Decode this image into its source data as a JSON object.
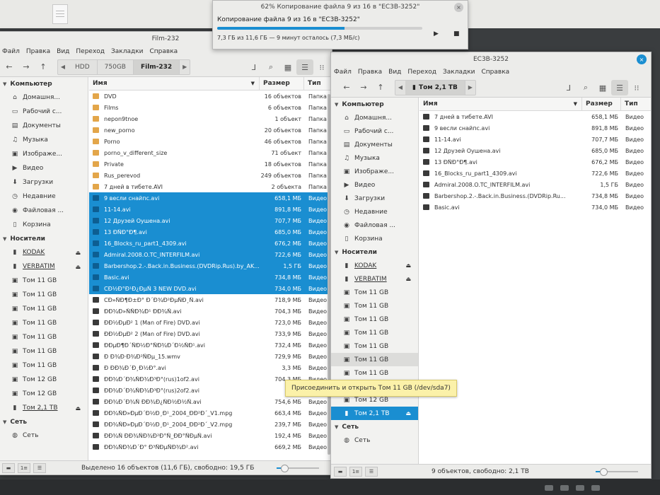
{
  "progress": {
    "title": "62% Копирование файла 9 из 16 в \"EC3B-3252\"",
    "main": "Копирование файла 9 из 16 в \"EC3B-3252\"",
    "detail": "7,3 ГБ из 11,6 ГБ — 9 минут осталось (7,3 МБ/с)",
    "percent": 62,
    "close_icon": "×",
    "play_icon": "▶",
    "stop_icon": "■"
  },
  "menu_labels": [
    "Файл",
    "Правка",
    "Вид",
    "Переход",
    "Закладки",
    "Справка"
  ],
  "left": {
    "title": "Film-232",
    "crumbs": [
      "HDD",
      "750GB",
      "Film-232"
    ],
    "sidebar": {
      "computer": "Компьютер",
      "places": [
        {
          "label": "Домашня...",
          "icon": "⌂"
        },
        {
          "label": "Рабочий с...",
          "icon": "▭"
        },
        {
          "label": "Документы",
          "icon": "▤"
        },
        {
          "label": "Музыка",
          "icon": "♫"
        },
        {
          "label": "Изображе...",
          "icon": "▣"
        },
        {
          "label": "Видео",
          "icon": "▶"
        },
        {
          "label": "Загрузки",
          "icon": "⬇"
        },
        {
          "label": "Недавние",
          "icon": "◷"
        },
        {
          "label": "Файловая ...",
          "icon": "◉"
        },
        {
          "label": "Корзина",
          "icon": "▯"
        }
      ],
      "devices_head": "Носители",
      "devices": [
        {
          "label": "KODAK",
          "icon": "▮",
          "eject": true,
          "u": true
        },
        {
          "label": "VERBATIM",
          "icon": "▮",
          "eject": true,
          "u": true
        },
        {
          "label": "Том 11 GB",
          "icon": "▣"
        },
        {
          "label": "Том 11 GB",
          "icon": "▣"
        },
        {
          "label": "Том 11 GB",
          "icon": "▣"
        },
        {
          "label": "Том 11 GB",
          "icon": "▣"
        },
        {
          "label": "Том 11 GB",
          "icon": "▣"
        },
        {
          "label": "Том 11 GB",
          "icon": "▣"
        },
        {
          "label": "Том 11 GB",
          "icon": "▣"
        },
        {
          "label": "Том 12 GB",
          "icon": "▣"
        },
        {
          "label": "Том 12 GB",
          "icon": "▣"
        },
        {
          "label": "Том 2,1 ТВ",
          "icon": "▮",
          "eject": true,
          "u": true
        }
      ],
      "network_head": "Сеть",
      "network": [
        {
          "label": "Сеть",
          "icon": "◍"
        }
      ]
    },
    "columns": [
      "Имя",
      "Размер",
      "Тип"
    ],
    "rows": [
      {
        "name": "DVD",
        "size": "16 объектов",
        "type": "Папка",
        "kind": "folder"
      },
      {
        "name": "Films",
        "size": "6 объектов",
        "type": "Папка",
        "kind": "folder"
      },
      {
        "name": "nepon9tnoe",
        "size": "1 объект",
        "type": "Папка",
        "kind": "folder"
      },
      {
        "name": "new_porno",
        "size": "20 объектов",
        "type": "Папка",
        "kind": "folder"
      },
      {
        "name": "Porno",
        "size": "46 объектов",
        "type": "Папка",
        "kind": "folder"
      },
      {
        "name": "porno_v_different_size",
        "size": "71 объект",
        "type": "Папка",
        "kind": "folder"
      },
      {
        "name": "Private",
        "size": "18 объектов",
        "type": "Папка",
        "kind": "folder"
      },
      {
        "name": "Rus_perevod",
        "size": "249 объектов",
        "type": "Папка",
        "kind": "folder"
      },
      {
        "name": "7 дней в тибете.AVI",
        "size": "2 объекта",
        "type": "Папка",
        "kind": "folder"
      },
      {
        "name": "9 весли снайпс.avi",
        "size": "658,1 МБ",
        "type": "Видео",
        "kind": "video",
        "sel": true
      },
      {
        "name": "11-14.avi",
        "size": "891,8 МБ",
        "type": "Видео",
        "kind": "video",
        "sel": true
      },
      {
        "name": "12 Друзей Оушена.avi",
        "size": "707,7 МБ",
        "type": "Видео",
        "kind": "video",
        "sel": true
      },
      {
        "name": "13 ÐÑÐ°Ð¶.avi",
        "size": "685,0 МБ",
        "type": "Видео",
        "kind": "video",
        "sel": true
      },
      {
        "name": "16_Blocks_ru_part1_4309.avi",
        "size": "676,2 МБ",
        "type": "Видео",
        "kind": "video",
        "sel": true
      },
      {
        "name": "Admiral.2008.O.TC_INTERFILM.avi",
        "size": "722,6 МБ",
        "type": "Видео",
        "kind": "video",
        "sel": true
      },
      {
        "name": "Barbershop.2.-.Back.in.Business.(DVDRip.Rus).by_AK...",
        "size": "1,5 ГБ",
        "type": "Видео",
        "kind": "video",
        "sel": true
      },
      {
        "name": "Basic.avi",
        "size": "734,8 МБ",
        "type": "Видео",
        "kind": "video",
        "sel": true
      },
      {
        "name": "CÐ½Ð°Ð¹Ð¿ÐµÑ 3 NEW DVD.avi",
        "size": "734,0 МБ",
        "type": "Видео",
        "kind": "video",
        "sel": true
      },
      {
        "name": "CÐ»ÑÐ¶Ð±Ð° Ð´Ð¾Ð²ÐµÑÐ¸Ñ.avi",
        "size": "718,9 МБ",
        "type": "Видео",
        "kind": "video"
      },
      {
        "name": "ÐÐ¾Ð»ÑÑÐ¾Ð¹ ÐÐ¾Ñ.avi",
        "size": "704,3 МБ",
        "type": "Видео",
        "kind": "video"
      },
      {
        "name": "ÐÐ½ÐµÐ² 1 (Man of Fire) DVD.avi",
        "size": "723,0 МБ",
        "type": "Видео",
        "kind": "video"
      },
      {
        "name": "ÐÐ½ÐµÐ² 2 (Man of Fire) DVD.avi",
        "size": "733,9 МБ",
        "type": "Видео",
        "kind": "video"
      },
      {
        "name": "ÐÐµÐ¶Ð´ÑÐ½Ð°ÑÐ¾Ð´Ð½ÑÐ¹.avi",
        "size": "732,4 МБ",
        "type": "Видео",
        "kind": "video"
      },
      {
        "name": "Ð Ð¾Ð·Ð¾Ð²ÑÐµ_15.wmv",
        "size": "729,9 МБ",
        "type": "Видео",
        "kind": "video"
      },
      {
        "name": "Ð ÐÐ¾Ð´Ð¸Ð½Ð°.avi",
        "size": "3,3 МБ",
        "type": "Видео",
        "kind": "video"
      },
      {
        "name": "ÐÐ¾Ð´Ð¾ÑÐ¾Ð³Ð°(rus)1of2.avi",
        "size": "704,3 МБ",
        "type": "Видео",
        "kind": "video"
      },
      {
        "name": "ÐÐ¾Ð´Ð¾ÑÐ¾Ð³Ð°(rus)2of2.avi",
        "size": "755,",
        "type": "Видео",
        "kind": "video"
      },
      {
        "name": "ÐÐ¾Ð´Ð¾Ñ ÐÐ¾Ð¿ÑÐ½Ð½Ñ.avi",
        "size": "754,6 МБ",
        "type": "Видео",
        "kind": "video"
      },
      {
        "name": "ÐÐ¾ÑÐ»ÐµÐ´Ð½Ð¸Ð¹_2004_ÐÐ²Ð´_V1.mpg",
        "size": "663,4 МБ",
        "type": "Видео",
        "kind": "video"
      },
      {
        "name": "ÐÐ¾ÑÐ»ÐµÐ´Ð½Ð¸Ð¹_2004_ÐÐ²Ð´_V2.mpg",
        "size": "239,7 МБ",
        "type": "Видео",
        "kind": "video"
      },
      {
        "name": "ÐÐ¾Ñ ÐÐ¾ÑÐ¾Ð²Ð°Ñ_ÐÐ°ÑÐµÑ.avi",
        "size": "192,4 МБ",
        "type": "Видео",
        "kind": "video"
      },
      {
        "name": "ÐÐ¾ÑÐ¾Ð´Ð° Ð³ÑÐµÑÐ¾Ð².avi",
        "size": "669,2 МБ",
        "type": "Видео",
        "kind": "video"
      }
    ],
    "status": "Выделено 16 объектов (11,6 ГБ), свободно: 19,5 ГБ"
  },
  "right": {
    "title": "EC3B-3252",
    "crumbs": [
      "Том 2,1 ТВ"
    ],
    "sidebar": {
      "computer": "Компьютер",
      "places": [
        {
          "label": "Домашня...",
          "icon": "⌂"
        },
        {
          "label": "Рабочий с...",
          "icon": "▭"
        },
        {
          "label": "Документы",
          "icon": "▤"
        },
        {
          "label": "Музыка",
          "icon": "♫"
        },
        {
          "label": "Изображе...",
          "icon": "▣"
        },
        {
          "label": "Видео",
          "icon": "▶"
        },
        {
          "label": "Загрузки",
          "icon": "⬇"
        },
        {
          "label": "Недавние",
          "icon": "◷"
        },
        {
          "label": "Файловая ...",
          "icon": "◉"
        },
        {
          "label": "Корзина",
          "icon": "▯"
        }
      ],
      "devices_head": "Носители",
      "devices": [
        {
          "label": "KODAK",
          "icon": "▮",
          "eject": true,
          "u": true
        },
        {
          "label": "VERBATIM",
          "icon": "▮",
          "eject": true,
          "u": true
        },
        {
          "label": "Том 11 GB",
          "icon": "▣"
        },
        {
          "label": "Том 11 GB",
          "icon": "▣"
        },
        {
          "label": "Том 11 GB",
          "icon": "▣"
        },
        {
          "label": "Том 11 GB",
          "icon": "▣"
        },
        {
          "label": "Том 11 GB",
          "icon": "▣"
        },
        {
          "label": "Том 11 GB",
          "icon": "▣",
          "hover": true
        },
        {
          "label": "Том 11 GB",
          "icon": "▣"
        },
        {
          "label": "Том 12 GB",
          "icon": "▣"
        },
        {
          "label": "Том 12 GB",
          "icon": "▣"
        },
        {
          "label": "Том 2,1 ТВ",
          "icon": "▮",
          "eject": true,
          "sel": true
        }
      ],
      "network_head": "Сеть",
      "network": [
        {
          "label": "Сеть",
          "icon": "◍"
        }
      ]
    },
    "columns": [
      "Имя",
      "Размер",
      "Тип"
    ],
    "rows": [
      {
        "name": "7 дней в тибете.AVI",
        "size": "658,1 МБ",
        "type": "Видео",
        "kind": "video"
      },
      {
        "name": "9 весли снайпс.avi",
        "size": "891,8 МБ",
        "type": "Видео",
        "kind": "video"
      },
      {
        "name": "11-14.avi",
        "size": "707,7 МБ",
        "type": "Видео",
        "kind": "video"
      },
      {
        "name": "12 Друзей Оушена.avi",
        "size": "685,0 МБ",
        "type": "Видео",
        "kind": "video"
      },
      {
        "name": "13 ÐÑÐ°Ð¶.avi",
        "size": "676,2 МБ",
        "type": "Видео",
        "kind": "video"
      },
      {
        "name": "16_Blocks_ru_part1_4309.avi",
        "size": "722,6 МБ",
        "type": "Видео",
        "kind": "video"
      },
      {
        "name": "Admiral.2008.O.TC_INTERFILM.avi",
        "size": "1,5 ГБ",
        "type": "Видео",
        "kind": "video"
      },
      {
        "name": "Barbershop.2.-.Back.in.Business.(DVDRip.Ru...",
        "size": "734,8 МБ",
        "type": "Видео",
        "kind": "video"
      },
      {
        "name": "Basic.avi",
        "size": "734,0 МБ",
        "type": "Видео",
        "kind": "video"
      }
    ],
    "status": "9 объектов, свободно: 2,1 ТВ"
  },
  "tooltip": "Присоединить и открыть Том 11 GB (/dev/sda7)",
  "toolbar_icons": {
    "back": "←",
    "forward": "→",
    "up": "↑",
    "prev_crumb": "◀",
    "next_crumb": "▶",
    "terminal": "⅃",
    "search": "⌕",
    "icon_view": "▦",
    "list_view": "☰",
    "compact_view": "⁝⁝",
    "sort_indicator": "▼",
    "close": "×"
  },
  "status_buttons": [
    "▬",
    "1≡",
    "☰"
  ],
  "colors": {
    "accent": "#1a8ed1",
    "folder": "#e3a64a"
  }
}
